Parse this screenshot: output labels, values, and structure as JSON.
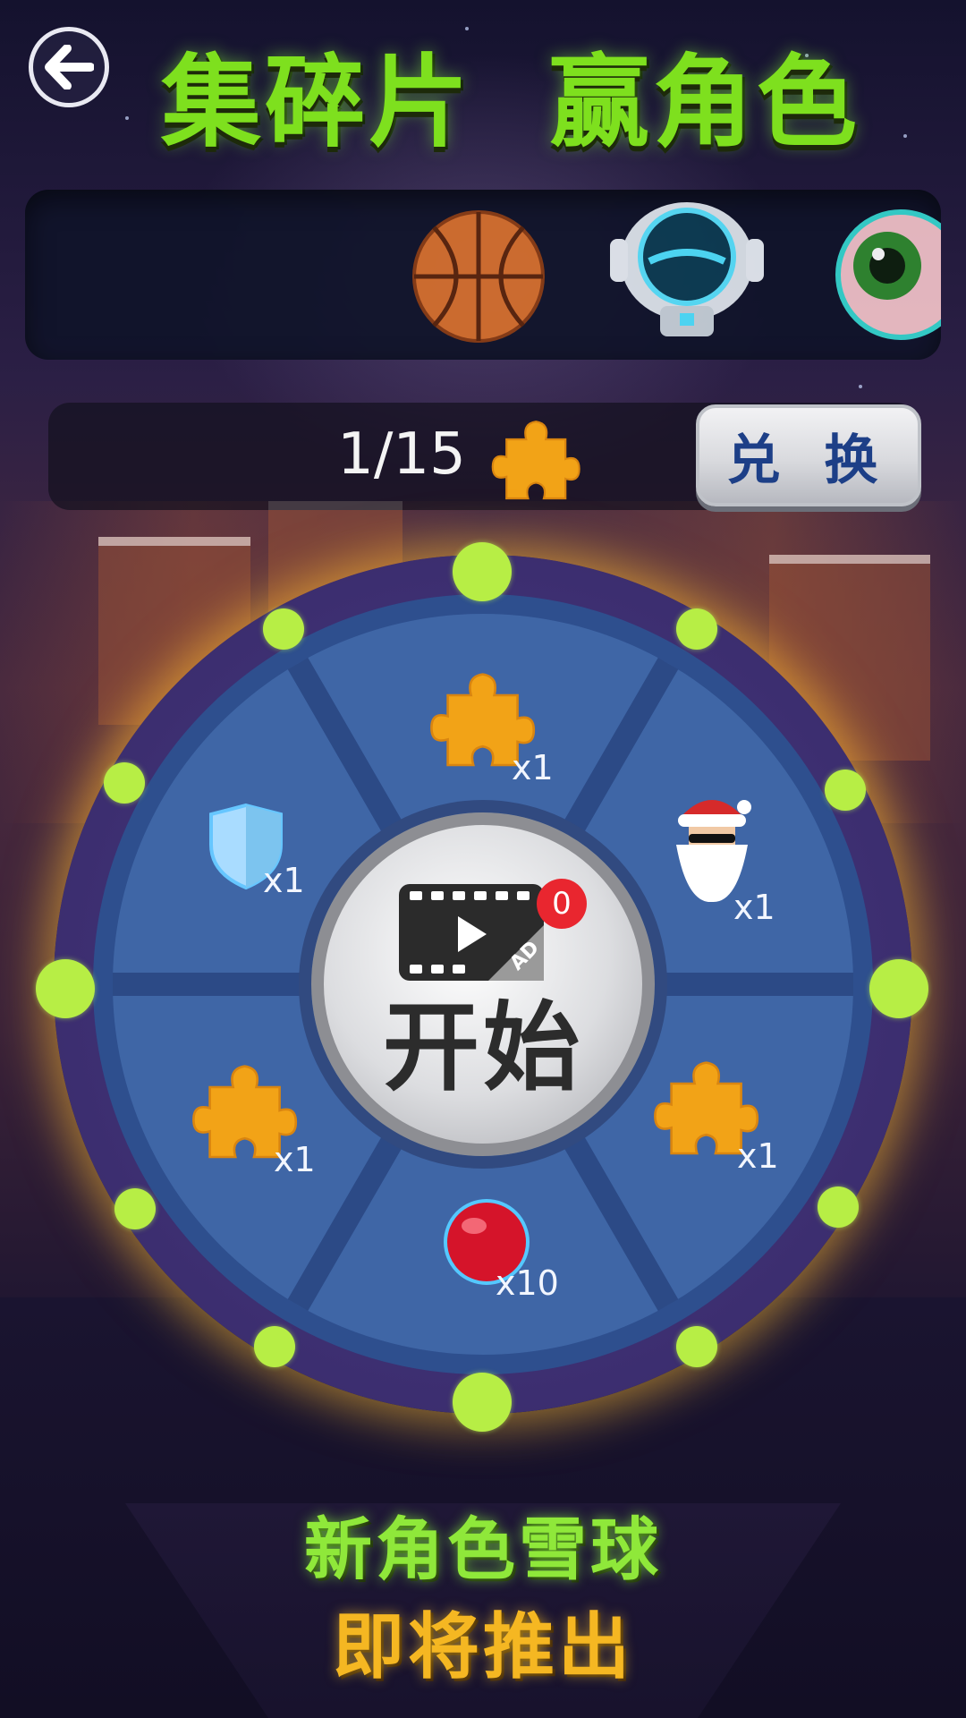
{
  "header": {
    "title": "集碎片  赢角色"
  },
  "carousel": {
    "items": [
      {
        "name": "basketball-character-icon"
      },
      {
        "name": "robot-character-icon"
      },
      {
        "name": "eyeball-character-icon"
      }
    ]
  },
  "progress": {
    "fraction_text": "1/15",
    "collected": 1,
    "total": 15,
    "icon": "puzzle-piece-icon"
  },
  "exchange_button": {
    "label": "兑 换"
  },
  "wheel": {
    "prizes": [
      {
        "icon": "puzzle-piece-icon",
        "label": "x1"
      },
      {
        "icon": "santa-character-icon",
        "label": "x1"
      },
      {
        "icon": "puzzle-piece-icon",
        "label": "x1"
      },
      {
        "icon": "red-ball-icon",
        "label": "x10"
      },
      {
        "icon": "puzzle-piece-icon",
        "label": "x1"
      },
      {
        "icon": "shield-icon",
        "label": "x1"
      }
    ],
    "start_button": {
      "label": "开始",
      "icon": "video-ad-icon",
      "badge_count": "0"
    },
    "colors": {
      "accent_dot": "#b7ee45",
      "face": "#3f66a6",
      "rim": "#3a2c6c"
    }
  },
  "footer": {
    "line1": "新角色雪球",
    "line2": "即将推出"
  }
}
